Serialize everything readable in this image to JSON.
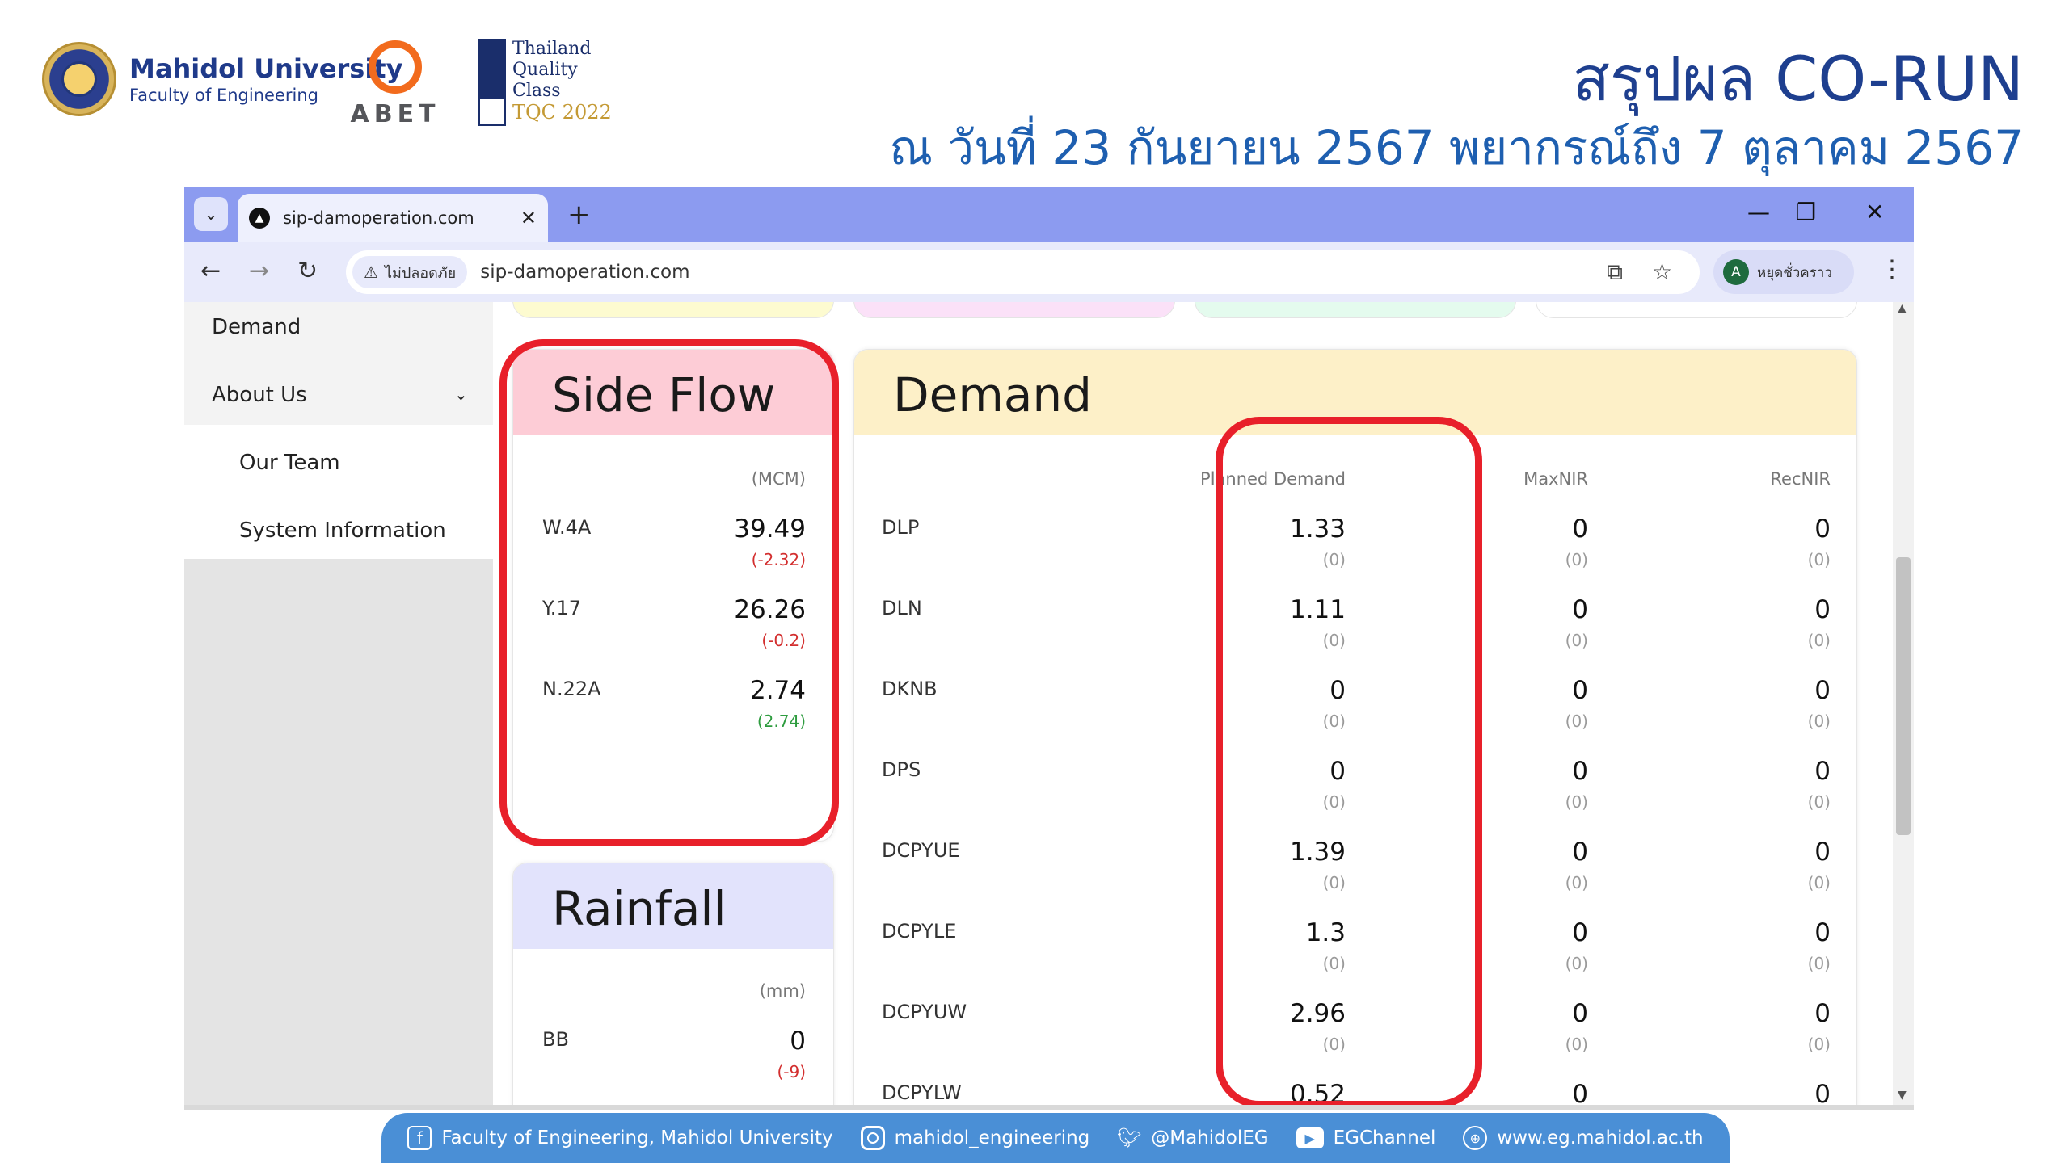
{
  "header": {
    "university_name": "Mahidol University",
    "faculty_name": "Faculty of Engineering",
    "abet_label": "ABET",
    "tqc_lines": [
      "Thailand",
      "Quality",
      "Class"
    ],
    "tqc_year": "TQC 2022",
    "title": "สรุปผล CO-RUN",
    "subtitle": "ณ วันที่ 23 กันยายน 2567 พยากรณ์ถึง 7 ตุลาคม 2567"
  },
  "browser": {
    "tab_title": "sip-damoperation.com",
    "tab_dropdown_icon": "⌄",
    "new_tab_icon": "+",
    "security_label": "ไม่ปลอดภัย",
    "url": "sip-damoperation.com",
    "profile_initial": "A",
    "profile_label": "หยุดชั่วคราว",
    "accent_color": "#8c9bf0"
  },
  "sidebar": {
    "items": [
      {
        "label": "Demand"
      },
      {
        "label": "About Us"
      },
      {
        "label": "Our Team"
      },
      {
        "label": "System Information"
      }
    ]
  },
  "side_flow": {
    "title": "Side Flow",
    "unit": "(MCM)",
    "rows": [
      {
        "name": "W.4A",
        "value": "39.49",
        "diff": "(-2.32)",
        "diff_color": "#d32f2f"
      },
      {
        "name": "Y.17",
        "value": "26.26",
        "diff": "(-0.2)",
        "diff_color": "#d32f2f"
      },
      {
        "name": "N.22A",
        "value": "2.74",
        "diff": "(2.74)",
        "diff_color": "#2e9c3f"
      }
    ]
  },
  "rainfall": {
    "title": "Rainfall",
    "unit": "(mm)",
    "rows": [
      {
        "name": "BB",
        "value": "0",
        "diff": "(-9)",
        "diff_color": "#d32f2f"
      }
    ]
  },
  "demand": {
    "title": "Demand",
    "columns": [
      "Planned Demand",
      "MaxNIR",
      "RecNIR"
    ],
    "rows": [
      {
        "name": "DLP",
        "planned": "1.33",
        "planned_diff": "(0)",
        "maxnir": "0",
        "maxnir_diff": "(0)",
        "recnir": "0",
        "recnir_diff": "(0)"
      },
      {
        "name": "DLN",
        "planned": "1.11",
        "planned_diff": "(0)",
        "maxnir": "0",
        "maxnir_diff": "(0)",
        "recnir": "0",
        "recnir_diff": "(0)"
      },
      {
        "name": "DKNB",
        "planned": "0",
        "planned_diff": "(0)",
        "maxnir": "0",
        "maxnir_diff": "(0)",
        "recnir": "0",
        "recnir_diff": "(0)"
      },
      {
        "name": "DPS",
        "planned": "0",
        "planned_diff": "(0)",
        "maxnir": "0",
        "maxnir_diff": "(0)",
        "recnir": "0",
        "recnir_diff": "(0)"
      },
      {
        "name": "DCPYUE",
        "planned": "1.39",
        "planned_diff": "(0)",
        "maxnir": "0",
        "maxnir_diff": "(0)",
        "recnir": "0",
        "recnir_diff": "(0)"
      },
      {
        "name": "DCPYLE",
        "planned": "1.3",
        "planned_diff": "(0)",
        "maxnir": "0",
        "maxnir_diff": "(0)",
        "recnir": "0",
        "recnir_diff": "(0)"
      },
      {
        "name": "DCPYUW",
        "planned": "2.96",
        "planned_diff": "(0)",
        "maxnir": "0",
        "maxnir_diff": "(0)",
        "recnir": "0",
        "recnir_diff": "(0)"
      },
      {
        "name": "DCPYLW",
        "planned": "0.52",
        "planned_diff": "",
        "maxnir": "0",
        "maxnir_diff": "",
        "recnir": "0",
        "recnir_diff": ""
      }
    ]
  },
  "colors": {
    "side_flow_header": "#fdccd6",
    "rainfall_header": "#e2e3fc",
    "demand_header": "#fdf0c8",
    "highlight": "#e8202a"
  },
  "footer": {
    "items": [
      {
        "icon": "facebook-icon",
        "label": "Faculty of Engineering, Mahidol University"
      },
      {
        "icon": "instagram-icon",
        "label": "mahidol_engineering"
      },
      {
        "icon": "twitter-icon",
        "label": "@MahidolEG"
      },
      {
        "icon": "youtube-icon",
        "label": "EGChannel"
      },
      {
        "icon": "globe-icon",
        "label": "www.eg.mahidol.ac.th"
      }
    ]
  }
}
